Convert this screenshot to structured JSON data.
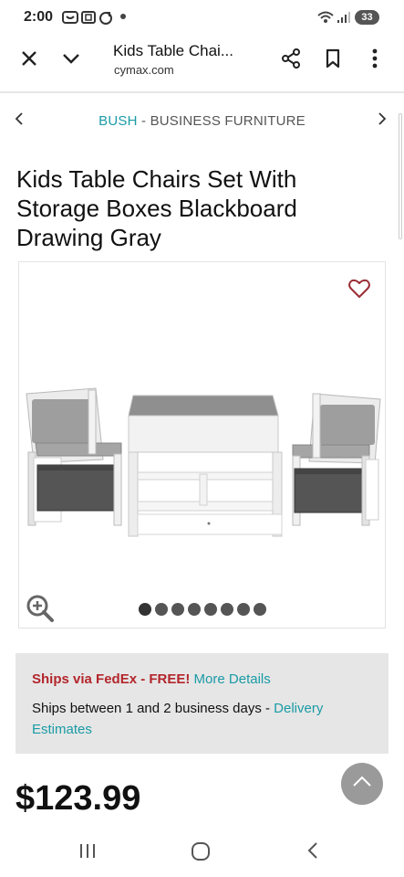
{
  "status_bar": {
    "time": "2:00",
    "battery": "33"
  },
  "browser": {
    "tab_title": "Kids Table Chai...",
    "url": "cymax.com"
  },
  "breadcrumb": {
    "brand": "BUSH",
    "separator": " - ",
    "category": "BUSINESS FURNITURE"
  },
  "product": {
    "title": "Kids Table Chairs Set With Storage Boxes Blackboard Drawing Gray",
    "price": "$123.99",
    "image_count": 8,
    "active_image": 1
  },
  "shipping": {
    "line1_prefix": "Ships via FedEx - FREE!",
    "line1_link": "More Details",
    "line2_prefix": "Ships between 1 and 2 business days - ",
    "line2_link": "Delivery Estimates"
  },
  "colors": {
    "accent": "#1a9ba6",
    "free_red": "#b3262c",
    "ship_bg": "#e6e6e6"
  }
}
